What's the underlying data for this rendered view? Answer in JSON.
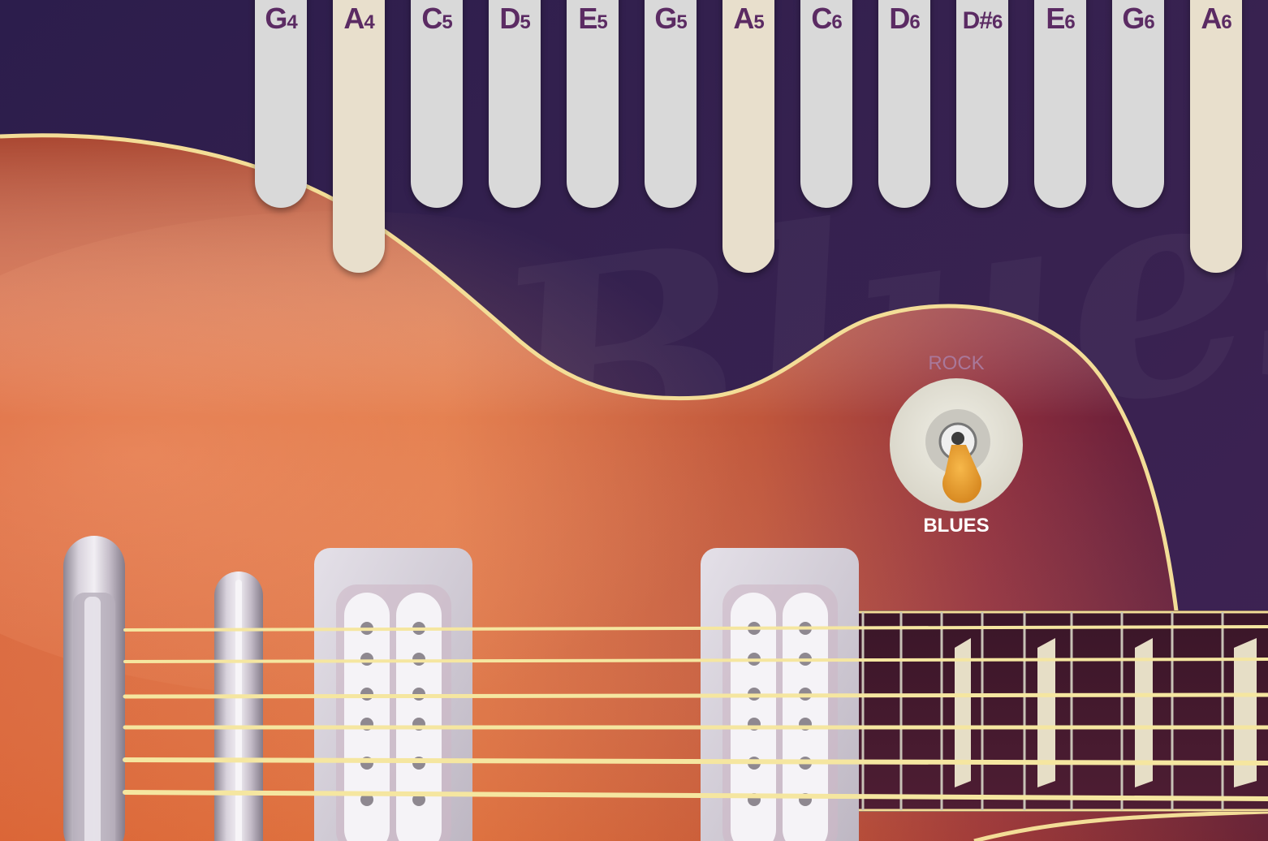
{
  "keys": [
    {
      "note": "G",
      "octave": "4",
      "highlight": false
    },
    {
      "note": "A",
      "octave": "4",
      "highlight": true
    },
    {
      "note": "C",
      "octave": "5",
      "highlight": false
    },
    {
      "note": "D",
      "octave": "5",
      "highlight": false
    },
    {
      "note": "E",
      "octave": "5",
      "highlight": false
    },
    {
      "note": "G",
      "octave": "5",
      "highlight": false
    },
    {
      "note": "A",
      "octave": "5",
      "highlight": true
    },
    {
      "note": "C",
      "octave": "6",
      "highlight": false
    },
    {
      "note": "D",
      "octave": "6",
      "highlight": false
    },
    {
      "note": "D#",
      "octave": "6",
      "highlight": false
    },
    {
      "note": "E",
      "octave": "6",
      "highlight": false
    },
    {
      "note": "G",
      "octave": "6",
      "highlight": false
    },
    {
      "note": "A",
      "octave": "6",
      "highlight": true
    }
  ],
  "toggle": {
    "top_label": "ROCK",
    "bottom_label": "BLUES",
    "selected": "BLUES"
  },
  "background_text": "Blues",
  "colors": {
    "background": "#2e1f4e",
    "key": "#d9d9d9",
    "key_highlight": "#e8dfcc",
    "key_text": "#5b2b63",
    "binding": "#f3dd97",
    "string": "#f5e6a0"
  }
}
